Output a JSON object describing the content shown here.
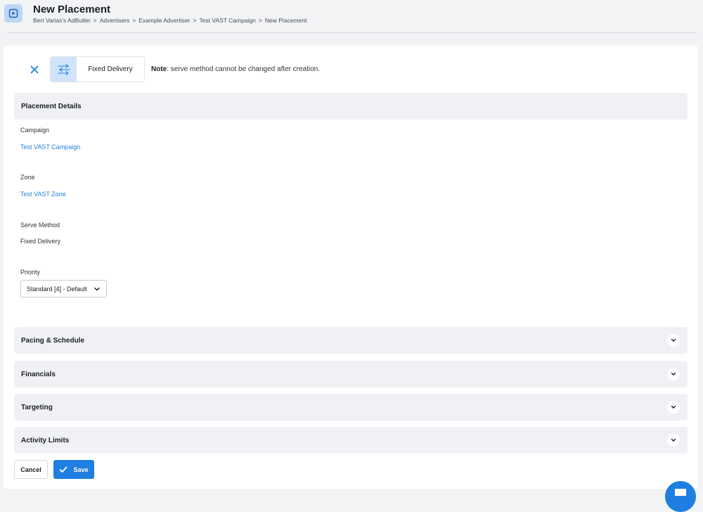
{
  "header": {
    "title": "New Placement",
    "breadcrumb": [
      "Bert Varias's AdButler",
      "Advertisers",
      "Example Advertiser",
      "Test VAST Campaign",
      "New Placement"
    ],
    "separator": ">"
  },
  "serve_method_chip": {
    "label": "Fixed Delivery",
    "icon": "arrows-exchange-icon"
  },
  "note": {
    "bold": "Note",
    "text": ": serve method cannot be changed after creation."
  },
  "placement_details": {
    "title": "Placement Details",
    "campaign_label": "Campaign",
    "campaign_value": "Test VAST Campaign",
    "zone_label": "Zone",
    "zone_value": "Test VAST Zone",
    "serve_method_label": "Serve Method",
    "serve_method_value": "Fixed Delivery",
    "priority_label": "Priority",
    "priority_value": "Standard [4] - Default"
  },
  "sections": {
    "pacing": "Pacing & Schedule",
    "financials": "Financials",
    "targeting": "Targeting",
    "activity_limits": "Activity Limits"
  },
  "actions": {
    "cancel": "Cancel",
    "save": "Save"
  },
  "colors": {
    "accent": "#1f7fe0",
    "link": "#1e7fd8",
    "section_bg": "#f0f1f4",
    "chip_icon_bg": "#cfe4fb"
  }
}
